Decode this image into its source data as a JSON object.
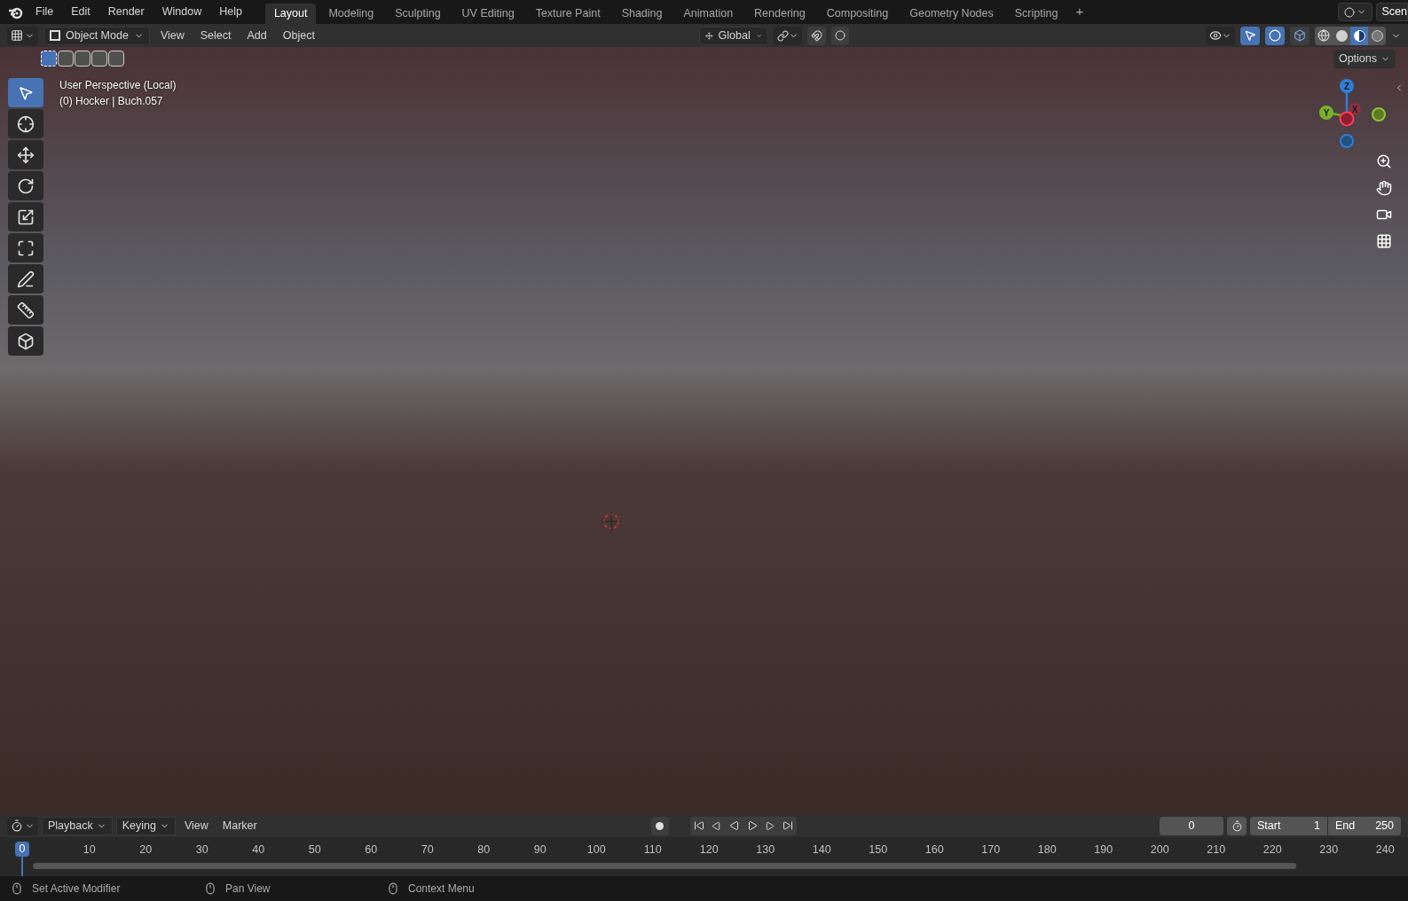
{
  "menu": [
    "File",
    "Edit",
    "Render",
    "Window",
    "Help"
  ],
  "workspaces": [
    {
      "label": "Layout",
      "selected": true
    },
    {
      "label": "Modeling",
      "selected": false
    },
    {
      "label": "Sculpting",
      "selected": false
    },
    {
      "label": "UV Editing",
      "selected": false
    },
    {
      "label": "Texture Paint",
      "selected": false
    },
    {
      "label": "Shading",
      "selected": false
    },
    {
      "label": "Animation",
      "selected": false
    },
    {
      "label": "Rendering",
      "selected": false
    },
    {
      "label": "Compositing",
      "selected": false
    },
    {
      "label": "Geometry Nodes",
      "selected": false
    },
    {
      "label": "Scripting",
      "selected": false
    }
  ],
  "add_workspace": "+",
  "scene": "Scen",
  "header": {
    "mode": "Object Mode",
    "menus": [
      "View",
      "Select",
      "Add",
      "Object"
    ],
    "orientation": "Global",
    "gizmos": {
      "on": true
    },
    "overlays": {
      "on": true
    },
    "xray": {
      "on": false
    },
    "shading": [
      {
        "kind": "wireframe",
        "selected": false
      },
      {
        "kind": "solid",
        "selected": false
      },
      {
        "kind": "material",
        "selected": true
      },
      {
        "kind": "rendered",
        "selected": false
      }
    ]
  },
  "select_modes": [
    {
      "selected": true
    },
    {
      "selected": false
    },
    {
      "selected": false
    },
    {
      "selected": false
    },
    {
      "selected": false
    }
  ],
  "tools": [
    {
      "kind": "select",
      "selected": true
    },
    {
      "kind": "cursor",
      "selected": false
    },
    {
      "kind": "move",
      "selected": false
    },
    {
      "kind": "rotate",
      "selected": false
    },
    {
      "kind": "scale",
      "selected": false
    },
    {
      "kind": "transform",
      "selected": false
    },
    {
      "kind": "annotate",
      "selected": false
    },
    {
      "kind": "measure",
      "selected": false
    },
    {
      "kind": "add-cube",
      "selected": false
    }
  ],
  "viewport": {
    "overlay_text": [
      "User Perspective (Local)",
      "(0) Hocker | Buch.057"
    ],
    "options": "Options",
    "axes": [
      "Z",
      "Y",
      "X"
    ]
  },
  "timeline": {
    "menus": [
      "Playback",
      "Keying",
      "View",
      "Marker"
    ],
    "current_frame": "0",
    "start_label": "Start",
    "start": "1",
    "end_label": "End",
    "end": "250",
    "playhead": "0",
    "ticks": [
      "10",
      "20",
      "30",
      "40",
      "50",
      "60",
      "70",
      "80",
      "90",
      "100",
      "110",
      "120",
      "130",
      "140",
      "150",
      "160",
      "170",
      "180",
      "190",
      "200",
      "210",
      "220",
      "230",
      "240"
    ]
  },
  "status_bar": [
    "Set Active Modifier",
    "Pan View",
    "Context Menu"
  ]
}
